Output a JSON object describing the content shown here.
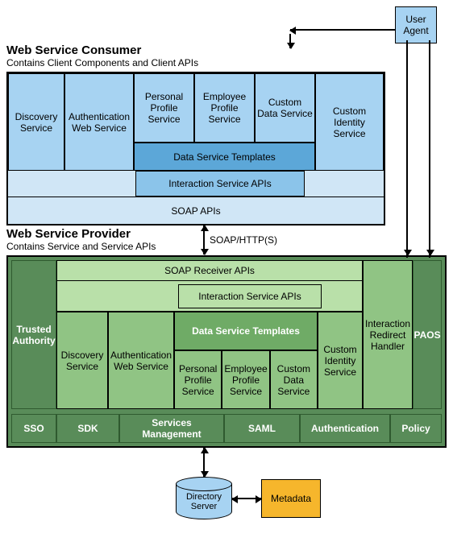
{
  "user_agent": "User Agent",
  "consumer": {
    "title": "Web Service Consumer",
    "subtitle": "Contains Client Components and Client APIs",
    "discovery": "Discovery Service",
    "auth": "Authentication Web Service",
    "pps": "Personal Profile Service",
    "eps": "Employee Profile Service",
    "cds": "Custom Data Service",
    "cis": "Custom Identity Service",
    "dst": "Data Service Templates",
    "isa": "Interaction Service APIs",
    "soap": "SOAP APIs"
  },
  "link_label": "SOAP/HTTP(S)",
  "provider": {
    "title": "Web Service Provider",
    "subtitle": "Contains Service and Service APIs",
    "trusted": "Trusted Authority",
    "soap_recv": "SOAP Receiver APIs",
    "isa": "Interaction Service APIs",
    "dst": "Data Service Templates",
    "discovery": "Discovery Service",
    "auth": "Authentication Web Service",
    "pps": "Personal Profile Service",
    "eps": "Employee Profile Service",
    "cds": "Custom Data Service",
    "cis": "Custom Identity Service",
    "irh": "Interaction Redirect Handler",
    "paos": "PAOS",
    "bottom": {
      "sso": "SSO",
      "sdk": "SDK",
      "sm": "Services Management",
      "saml": "SAML",
      "auth": "Authentication",
      "policy": "Policy"
    }
  },
  "directory": "Directory Server",
  "metadata": "Metadata"
}
